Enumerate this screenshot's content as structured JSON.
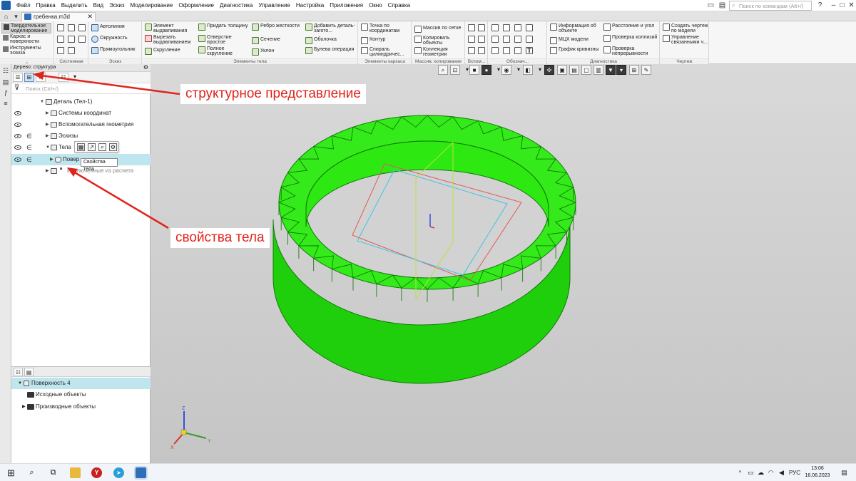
{
  "menu": [
    "Файл",
    "Правка",
    "Выделить",
    "Вид",
    "Эскиз",
    "Моделирование",
    "Оформление",
    "Диагностика",
    "Управление",
    "Настройка",
    "Приложения",
    "Окно",
    "Справка"
  ],
  "command_search": {
    "placeholder": "Поиск по командам (Alt+/)"
  },
  "document_tab": {
    "label": "гребенка.m3d"
  },
  "ribbon": {
    "modes": [
      "Твердотельное моделирование",
      "Каркас и поверхности",
      "Инструменты эскиза"
    ],
    "groups": {
      "system": "Системная",
      "sketch": "Эскиз",
      "body_elements": "Элементы тела",
      "wireframe": "Элементы каркаса",
      "array": "Массив, копирование",
      "aux": "Вспом...",
      "notation": "Обознач...",
      "diagnostics": "Диагностика",
      "drawing": "Чертеж"
    },
    "sketch_buttons": [
      "Автолиния",
      "Окружность",
      "Прямоугольник"
    ],
    "body_buttons": {
      "col1": [
        "Элемент выдавливания",
        "Вырезать выдавливанием",
        "Скругление"
      ],
      "col2": [
        "Придать толщину",
        "Отверстие простое",
        "Полное скругление"
      ],
      "col3": [
        "Ребро жесткости",
        "Сечение",
        "Уклон"
      ],
      "col4": [
        "Добавить деталь-загото...",
        "Оболочка",
        "Булева операция"
      ]
    },
    "wire_buttons": [
      "Точка по координатам",
      "Контур",
      "Спираль цилиндричес..."
    ],
    "array_buttons": [
      "Массив по сетке",
      "Копировать объекты",
      "Коллекция геометрии"
    ],
    "diag_buttons": {
      "col1": [
        "Информация об объекте",
        "МЦХ модели",
        "График кривизны"
      ],
      "col2": [
        "Расстояние и угол",
        "Проверка коллизий",
        "Проверка непрерывности"
      ]
    },
    "drawing_buttons": [
      "Создать чертеж по модели",
      "Управление связанными ч..."
    ]
  },
  "tree": {
    "title": "Дерево: структура",
    "search_placeholder": "Поиск (Ctrl+/)",
    "rows": [
      {
        "label": "Деталь (Тел-1)"
      },
      {
        "label": "Системы координат"
      },
      {
        "label": "Вспомогательная геометрия"
      },
      {
        "label": "Эскизы"
      },
      {
        "label": "Тела"
      },
      {
        "label": "Повер"
      },
      {
        "label": "Исключенные из расчета"
      }
    ],
    "tooltip": "Свойства тела"
  },
  "properties_tree": {
    "rows": [
      {
        "label": "Поверхность 4"
      },
      {
        "label": "Исходные объекты"
      },
      {
        "label": "Производные объекты"
      }
    ]
  },
  "annotations": {
    "structure_view": "структурное представление",
    "body_properties": "свойства тела"
  },
  "axes": {
    "z": "Z",
    "x": "X",
    "y": "Y"
  },
  "taskbar": {
    "language": "РУС",
    "time": "13:06",
    "date": "16.06.2023"
  },
  "colors": {
    "model_green": "#2ee812",
    "annotation_red": "#e0241c",
    "selection": "#bfe6ef"
  }
}
